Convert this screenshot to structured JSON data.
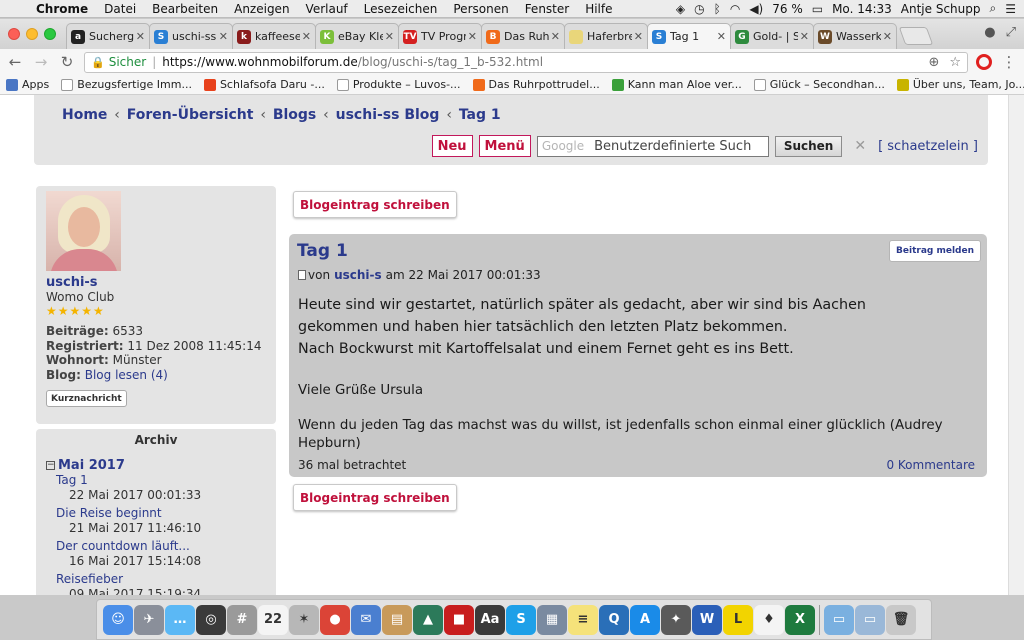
{
  "menubar": {
    "app": "Chrome",
    "items": [
      "Datei",
      "Bearbeiten",
      "Anzeigen",
      "Verlauf",
      "Lesezeichen",
      "Personen",
      "Fenster",
      "Hilfe"
    ],
    "battery": "76 %",
    "clock": "Mo. 14:33",
    "user": "Antje Schupp"
  },
  "tabs": [
    {
      "label": "Sucherge",
      "color": "#222222",
      "glyph": "a"
    },
    {
      "label": "uschi-ss",
      "color": "#2a7fd4",
      "glyph": "S"
    },
    {
      "label": "kaffeeser",
      "color": "#8a1c1c",
      "glyph": "k"
    },
    {
      "label": "eBay Klei",
      "color": "#7cbf3a",
      "glyph": "K"
    },
    {
      "label": "TV Progr",
      "color": "#d42020",
      "glyph": "TV"
    },
    {
      "label": "Das Ruhr",
      "color": "#f06a1a",
      "glyph": "B"
    },
    {
      "label": "Haferbre",
      "color": "#e9d67a",
      "glyph": ""
    },
    {
      "label": "Tag 1",
      "color": "#2a7fd4",
      "glyph": "S"
    },
    {
      "label": "Gold- | S",
      "color": "#2e8b3e",
      "glyph": "G"
    },
    {
      "label": "Wasserke",
      "color": "#6b4b2a",
      "glyph": "W"
    }
  ],
  "toolbar": {
    "secure_label": "Sicher",
    "url_host": "https://www.wohnmobilforum.de",
    "url_path": "/blog/uschi-s/tag_1_b-532.html"
  },
  "bookmarks": [
    {
      "label": "Apps",
      "color": "#4a76c4"
    },
    {
      "label": "Bezugsfertige Imm...",
      "color": "#ffffff"
    },
    {
      "label": "Schlafsofa Daru -...",
      "color": "#e8421c"
    },
    {
      "label": "Produkte – Luvos-...",
      "color": "#ffffff"
    },
    {
      "label": "Das Ruhrpottrudel...",
      "color": "#f06a1a"
    },
    {
      "label": "Kann man Aloe ver...",
      "color": "#3aa03a"
    },
    {
      "label": "Glück – Secondhan...",
      "color": "#ffffff"
    },
    {
      "label": "Über uns, Team, Jo...",
      "color": "#c8b400"
    }
  ],
  "header": {
    "breadcrumbs": [
      "Home",
      "Foren-Übersicht",
      "Blogs",
      "uschi-ss Blog",
      "Tag 1"
    ],
    "crumb_sep": "‹",
    "btn_new": "Neu",
    "btn_menu": "Menü",
    "search_logo": "Google",
    "search_placeholder": "Benutzerdefinierte Such",
    "search_button": "Suchen",
    "user_link": "[ schaetzelein ]"
  },
  "profile": {
    "name": "uschi-s",
    "rank": "Womo Club",
    "stars": "★★★★★",
    "posts_label": "Beiträge:",
    "posts_value": "6533",
    "registered_label": "Registriert:",
    "registered_value": "11 Dez 2008 11:45:14",
    "location_label": "Wohnort:",
    "location_value": "Münster",
    "blog_label": "Blog:",
    "blog_value": "Blog lesen (4)",
    "message_button": "Kurznachricht"
  },
  "archive": {
    "title": "Archiv",
    "month": "Mai 2017",
    "items": [
      {
        "title": "Tag 1",
        "date": "22 Mai 2017 00:01:33"
      },
      {
        "title": "Die Reise beginnt",
        "date": "21 Mai 2017 11:46:10"
      },
      {
        "title": "Der countdown läuft...",
        "date": "16 Mai 2017 15:14:08"
      },
      {
        "title": "Reisefieber",
        "date": "09 Mai 2017 15:19:34"
      }
    ]
  },
  "post": {
    "write_button": "Blogeintrag schreiben",
    "title": "Tag 1",
    "report_button": "Beitrag melden",
    "by": "von",
    "author": "uschi-s",
    "date": "am 22 Mai 2017 00:01:33",
    "line1": "Heute sind wir gestartet, natürlich später als gedacht, aber wir sind bis Aachen",
    "line2": "gekommen und haben hier tatsächlich den letzten Platz bekommen.",
    "line3": "Nach Bockwurst mit Kartoffelsalat und einem Fernet geht es ins Bett.",
    "greeting": "Viele Grüße Ursula",
    "signature": "Wenn du jeden Tag das machst was du willst, ist jedenfalls schon einmal einer glücklich (Audrey Hepburn)",
    "views": "36 mal betrachtet",
    "comments": "0 Kommentare"
  },
  "dock": [
    {
      "name": "finder-icon",
      "color": "#4a8ee8",
      "glyph": "☺"
    },
    {
      "name": "launchpad-icon",
      "color": "#8a8f9a",
      "glyph": "✈"
    },
    {
      "name": "messages-icon",
      "color": "#5bb8f5",
      "glyph": "…"
    },
    {
      "name": "safari-icon",
      "color": "#3a3a3a",
      "glyph": "◎"
    },
    {
      "name": "calculator-icon",
      "color": "#9a9a9a",
      "glyph": "#"
    },
    {
      "name": "calendar-icon",
      "color": "#f4f4f4",
      "glyph": "22"
    },
    {
      "name": "app-icon-compass",
      "color": "#b7b7b7",
      "glyph": "✶"
    },
    {
      "name": "chrome-icon",
      "color": "#db4437",
      "glyph": "●"
    },
    {
      "name": "mail-icon",
      "color": "#4a7fd0",
      "glyph": "✉"
    },
    {
      "name": "contacts-icon",
      "color": "#c89a5a",
      "glyph": "▤"
    },
    {
      "name": "photo-icon",
      "color": "#2c7a5a",
      "glyph": "▲"
    },
    {
      "name": "photobooth-icon",
      "color": "#c81e1e",
      "glyph": "■"
    },
    {
      "name": "dictionary-icon",
      "color": "#3a3a3a",
      "glyph": "Aa"
    },
    {
      "name": "skype-icon",
      "color": "#1ea0e8",
      "glyph": "S"
    },
    {
      "name": "preview-icon",
      "color": "#7a8aa0",
      "glyph": "▦"
    },
    {
      "name": "notes-icon",
      "color": "#f5e27a",
      "glyph": "≡"
    },
    {
      "name": "quicktime-icon",
      "color": "#2a6fb8",
      "glyph": "Q"
    },
    {
      "name": "appstore-icon",
      "color": "#1a8be8",
      "glyph": "A"
    },
    {
      "name": "spotlight-app-icon",
      "color": "#5a5a5a",
      "glyph": "✦"
    },
    {
      "name": "word-icon",
      "color": "#2b5fb8",
      "glyph": "W"
    },
    {
      "name": "lidl-icon",
      "color": "#f2d400",
      "glyph": "L"
    },
    {
      "name": "cards-icon",
      "color": "#f4f4f4",
      "glyph": "♦"
    },
    {
      "name": "excel-icon",
      "color": "#1e7a3e",
      "glyph": "X"
    },
    {
      "name": "folder-icon",
      "color": "#7ab0e0",
      "glyph": "▭"
    },
    {
      "name": "downloads-icon",
      "color": "#9ab8d8",
      "glyph": "▭"
    },
    {
      "name": "trash-icon",
      "color": "#c8c8c8",
      "glyph": "🗑"
    }
  ]
}
